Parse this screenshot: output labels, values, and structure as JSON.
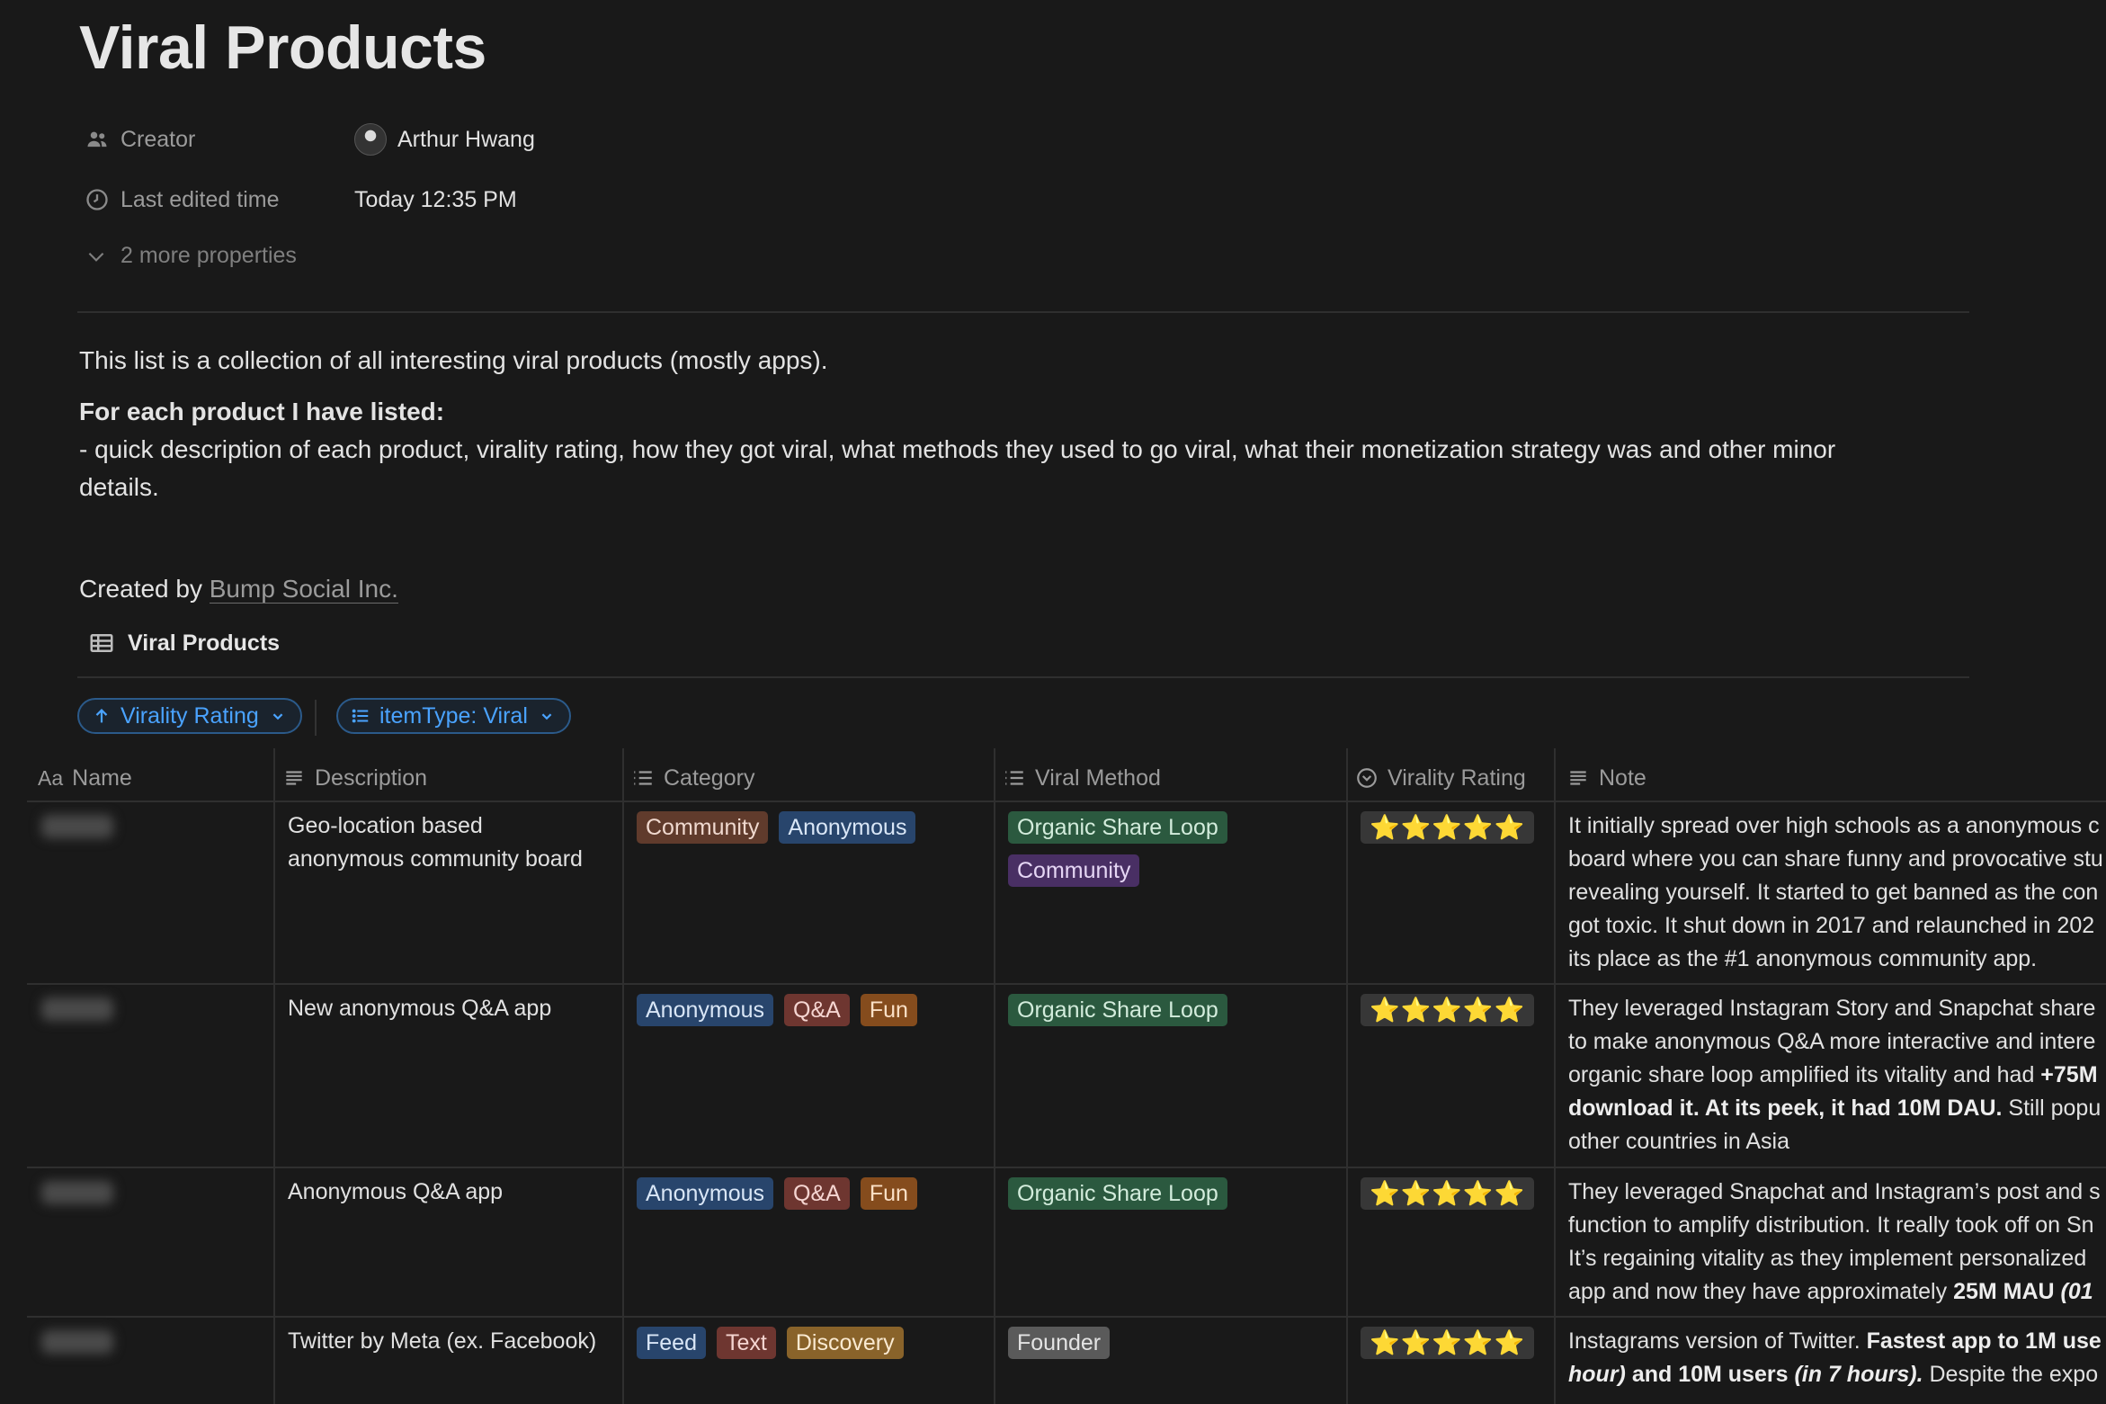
{
  "page": {
    "title": "Viral Products",
    "properties": [
      {
        "label": "Creator",
        "icon": "people-icon",
        "value": "Arthur Hwang"
      },
      {
        "label": "Last edited time",
        "icon": "clock-icon",
        "value": "Today 12:35 PM"
      }
    ],
    "more_properties": "2 more properties",
    "intro": "This list is a collection of all interesting viral products (mostly apps).",
    "listed_heading": "For each product I have listed:",
    "listed_line1": "- quick description of each product, virality rating, how they got viral, what methods they used to go viral, what their monetization strategy was and other minor",
    "listed_line2": "details.",
    "created_by_prefix": "Created by",
    "created_by_link": "Bump Social Inc."
  },
  "database": {
    "title": "Viral Products",
    "filters": {
      "sort_label": "Virality Rating",
      "filter_label": "itemType: Viral"
    },
    "columns": {
      "name": "Name",
      "name_prefix": "Aa",
      "description": "Description",
      "category": "Category",
      "viral_method": "Viral Method",
      "virality_rating": "Virality Rating",
      "note": "Note"
    },
    "rows": [
      {
        "description_l1": "Geo-location based",
        "description_l2": "anonymous community board",
        "category": [
          "Community",
          "Anonymous"
        ],
        "viral_method": [
          "Organic Share Loop",
          "Community"
        ],
        "rating": "⭐⭐⭐⭐⭐",
        "note_lines": [
          "It initially spread over high schools as a anonymous c",
          "board where you can share funny and provocative stu",
          "revealing yourself. It started to get banned as the con",
          "got toxic. It shut down in 2017 and relaunched in 202",
          "its place as the #1 anonymous community app."
        ]
      },
      {
        "description_l1": "New anonymous Q&A app",
        "category": [
          "Anonymous",
          "Q&A",
          "Fun"
        ],
        "viral_method": [
          "Organic Share Loop"
        ],
        "rating": "⭐⭐⭐⭐⭐",
        "note_lines": [
          "They leveraged Instagram Story and Snapchat share",
          "to make anonymous Q&A more interactive and intere",
          "organic share loop amplified its vitality and had ",
          "download it. At its peek, it had 10M DAU.",
          "other countries in Asia"
        ],
        "note_bold_a": "+75M",
        "note_rest_b": " Still popu"
      },
      {
        "description_l1": "Anonymous Q&A app",
        "category": [
          "Anonymous",
          "Q&A",
          "Fun"
        ],
        "viral_method": [
          "Organic Share Loop"
        ],
        "rating": "⭐⭐⭐⭐⭐",
        "note_lines": [
          "They leveraged Snapchat and Instagram’s post and s",
          "function to amplify distribution. It really took off on Sn",
          "It’s regaining vitality as they implement personalized",
          "app and now they have approximately "
        ],
        "note_bold_a": "25M MAU",
        "note_italic_b": " (01"
      },
      {
        "description_l1": "Twitter by Meta (ex. Facebook)",
        "category": [
          "Feed",
          "Text",
          "Discovery"
        ],
        "viral_method": [
          "Founder"
        ],
        "rating": "⭐⭐⭐⭐⭐",
        "note_lines": [
          "Instagrams version of Twitter. ",
          " and 10M users",
          " Despite the expo"
        ],
        "note_bold_a": "Fastest app to 1M use",
        "note_bold_b": "hour)",
        "note_italic_c": "(in 7 hours)."
      }
    ]
  },
  "colors": {
    "background": "#191919",
    "accent": "#4aa3ff",
    "star": "#f6c542"
  }
}
